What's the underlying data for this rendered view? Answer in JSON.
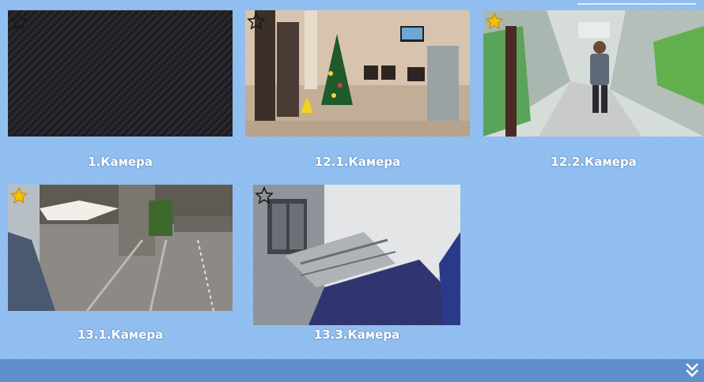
{
  "cameras": [
    {
      "label": "1.Камера",
      "favorite": false,
      "state": "no-signal"
    },
    {
      "label": "12.1.Камера",
      "favorite": false,
      "state": "live"
    },
    {
      "label": "12.2.Камера",
      "favorite": true,
      "state": "live"
    },
    {
      "label": "13.1.Камера",
      "favorite": true,
      "state": "live"
    },
    {
      "label": "13.3.Камера",
      "favorite": false,
      "state": "live"
    }
  ],
  "colors": {
    "background": "#8fbdf0",
    "bottom_bar": "#5f8fca",
    "star_active": "#f5c000",
    "star_inactive": "#2a2a2a"
  },
  "icons": {
    "favorite": "star-icon",
    "expand": "chevron-double-down-icon"
  }
}
